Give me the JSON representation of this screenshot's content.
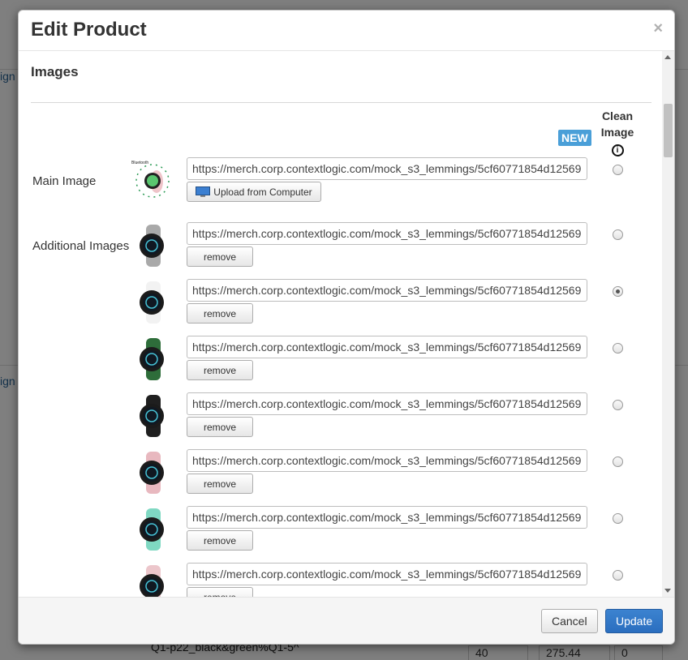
{
  "background": {
    "link_fragment_1": "ign",
    "link_fragment_2": "ign",
    "row_text": "Q1-p22_black&green%Q1-5^",
    "cells": [
      "40",
      "275.44",
      "0"
    ]
  },
  "modal": {
    "title": "Edit Product",
    "close_symbol": "×",
    "section_title": "Images",
    "new_badge": "NEW",
    "clean_image_label": "Clean Image",
    "info_symbol": "i",
    "main_image_label": "Main Image",
    "additional_images_label": "Additional Images",
    "upload_button_label": "Upload from Computer",
    "remove_label": "remove",
    "main_image": {
      "url": "https://merch.corp.contextlogic.com/mock_s3_lemmings/5cf60771854d12569",
      "clean_selected": false
    },
    "additional_images": [
      {
        "url": "https://merch.corp.contextlogic.com/mock_s3_lemmings/5cf60771854d12569",
        "clean_selected": false,
        "watch_color": "#a9a9a9"
      },
      {
        "url": "https://merch.corp.contextlogic.com/mock_s3_lemmings/5cf60771854d12569",
        "clean_selected": true,
        "watch_color": "#f2f2f2"
      },
      {
        "url": "https://merch.corp.contextlogic.com/mock_s3_lemmings/5cf60771854d12569",
        "clean_selected": false,
        "watch_color": "#2e6d3a"
      },
      {
        "url": "https://merch.corp.contextlogic.com/mock_s3_lemmings/5cf60771854d12569",
        "clean_selected": false,
        "watch_color": "#1f1f1f"
      },
      {
        "url": "https://merch.corp.contextlogic.com/mock_s3_lemmings/5cf60771854d12569",
        "clean_selected": false,
        "watch_color": "#e8b8bf"
      },
      {
        "url": "https://merch.corp.contextlogic.com/mock_s3_lemmings/5cf60771854d12569",
        "clean_selected": false,
        "watch_color": "#7fd8c2"
      },
      {
        "url": "https://merch.corp.contextlogic.com/mock_s3_lemmings/5cf60771854d12569",
        "clean_selected": false,
        "watch_color": "#ecc6cb"
      }
    ],
    "footer": {
      "cancel_label": "Cancel",
      "update_label": "Update"
    },
    "colors": {
      "new_badge": "#4a9fd8",
      "update_button": "#2e75c7"
    }
  }
}
